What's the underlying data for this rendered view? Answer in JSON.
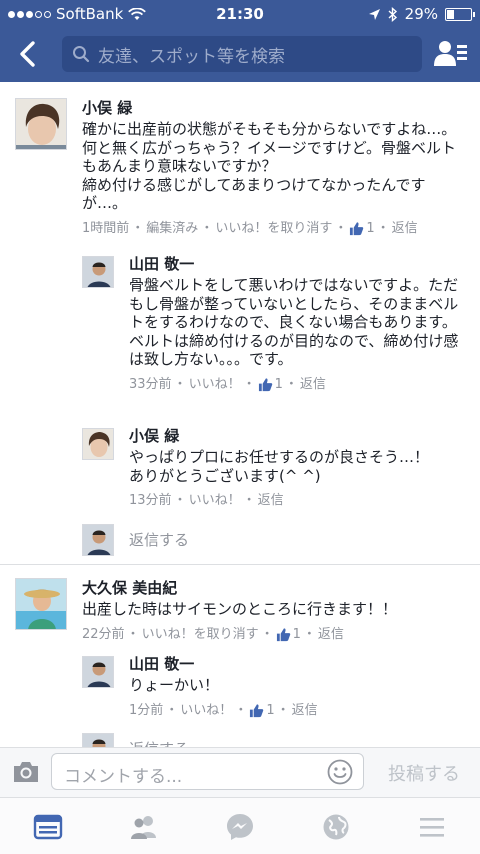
{
  "status_bar": {
    "carrier": "SoftBank",
    "time": "21:30",
    "battery": "29%",
    "battery_level": 0.29
  },
  "nav": {
    "search_placeholder": "友達、スポット等を検索"
  },
  "comments": [
    {
      "name": "小俣 緑",
      "text": "確かに出産前の状態がそもそも分からないですよね…。何と無く広がっちゃう？イメージですけど。骨盤ベルトもあんまり意味ないですか？\n締め付ける感じがしてあまりつけてなかったんですが…。",
      "time": "1時間前",
      "edited": "編集済み",
      "like_action": "いいね！を取り消す",
      "likes": "1",
      "reply": "返信",
      "replies": [
        {
          "name": "山田 敬一",
          "text": "骨盤ベルトをして悪いわけではないですよ。ただもし骨盤が整っていないとしたら、そのままベルトをするわけなので、良くない場合もあります。\nベルトは締め付けるのが目的なので、締め付け感は致し方ない。。。です。",
          "time": "33分前",
          "like_action": "いいね！",
          "likes": "1",
          "reply": "返信"
        },
        {
          "name": "小俣 緑",
          "text": "やっぱりプロにお任せするのが良さそう…！\nありがとうございます(^ ^)",
          "time": "13分前",
          "like_action": "いいね！",
          "reply": "返信"
        }
      ],
      "reply_prompt": "返信する"
    },
    {
      "name": "大久保 美由紀",
      "text": "出産した時はサイモンのところに行きます！！",
      "time": "22分前",
      "like_action": "いいね！を取り消す",
      "likes": "1",
      "reply": "返信",
      "replies": [
        {
          "name": "山田 敬一",
          "text": "りょーかい！",
          "time": "1分前",
          "like_action": "いいね！",
          "likes": "1",
          "reply": "返信"
        }
      ],
      "reply_prompt": "返信する"
    }
  ],
  "composer": {
    "placeholder": "コメントする...",
    "post_label": "投稿する"
  },
  "tabs": [
    "news-feed",
    "friends",
    "messenger",
    "notifications",
    "more"
  ],
  "colors": {
    "brand": "#3b5998",
    "like_blue": "#4267b2",
    "meta_gray": "#90949c"
  }
}
